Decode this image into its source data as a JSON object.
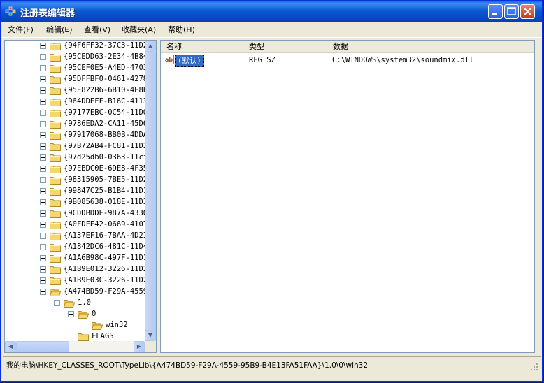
{
  "window": {
    "title": "注册表编辑器"
  },
  "menu": [
    "文件(F)",
    "编辑(E)",
    "查看(V)",
    "收藏夹(A)",
    "帮助(H)"
  ],
  "tree": [
    {
      "label": "{94F6FF32-37C3-11D2",
      "depth": 0,
      "expander": "plus"
    },
    {
      "label": "{95CEDD63-2E34-4B84",
      "depth": 0,
      "expander": "plus"
    },
    {
      "label": "{95CEF0E5-A4ED-4703",
      "depth": 0,
      "expander": "plus"
    },
    {
      "label": "{95DFFBF0-0461-4278",
      "depth": 0,
      "expander": "plus"
    },
    {
      "label": "{95E822B6-6B10-4E8E",
      "depth": 0,
      "expander": "plus"
    },
    {
      "label": "{964DDEFF-B16C-4113",
      "depth": 0,
      "expander": "plus"
    },
    {
      "label": "{97177EBC-0C54-11D0",
      "depth": 0,
      "expander": "plus"
    },
    {
      "label": "{9786EDA2-CA11-45D6",
      "depth": 0,
      "expander": "plus"
    },
    {
      "label": "{97917068-BB0B-4DDA",
      "depth": 0,
      "expander": "plus"
    },
    {
      "label": "{97B72AB4-FC81-11D2",
      "depth": 0,
      "expander": "plus"
    },
    {
      "label": "{97d25db0-0363-11cf",
      "depth": 0,
      "expander": "plus"
    },
    {
      "label": "{97EBDC0E-6DE8-4F35",
      "depth": 0,
      "expander": "plus"
    },
    {
      "label": "{98315905-7BE5-11D2",
      "depth": 0,
      "expander": "plus"
    },
    {
      "label": "{99847C25-B1B4-11D1",
      "depth": 0,
      "expander": "plus"
    },
    {
      "label": "{9B085638-018E-11D3",
      "depth": 0,
      "expander": "plus"
    },
    {
      "label": "{9CDDBDDE-987A-4330",
      "depth": 0,
      "expander": "plus"
    },
    {
      "label": "{A0FDFE42-0669-4107",
      "depth": 0,
      "expander": "plus"
    },
    {
      "label": "{A137EF16-7BAA-4D2I",
      "depth": 0,
      "expander": "plus"
    },
    {
      "label": "{A1842DC6-481C-11D4",
      "depth": 0,
      "expander": "plus"
    },
    {
      "label": "{A1A6B98C-497F-11D1",
      "depth": 0,
      "expander": "plus"
    },
    {
      "label": "{A1B9E012-3226-11D2",
      "depth": 0,
      "expander": "plus"
    },
    {
      "label": "{A1B9E03C-3226-11D2",
      "depth": 0,
      "expander": "plus"
    },
    {
      "label": "{A474BD59-F29A-4559",
      "depth": 0,
      "expander": "minus"
    },
    {
      "label": "1.0",
      "depth": 1,
      "expander": "minus"
    },
    {
      "label": "0",
      "depth": 2,
      "expander": "minus"
    },
    {
      "label": "win32",
      "depth": 3,
      "expander": "none"
    },
    {
      "label": "FLAGS",
      "depth": 2,
      "expander": "none"
    }
  ],
  "list": {
    "headers": [
      "名称",
      "类型",
      "数据"
    ],
    "rows": [
      {
        "name": "(默认)",
        "type": "REG_SZ",
        "data": "C:\\WINDOWS\\system32\\soundmix.dll"
      }
    ]
  },
  "status": {
    "path": "我的电脑\\HKEY_CLASSES_ROOT\\TypeLib\\{A474BD59-F29A-4559-95B9-B4E13FA51FAA}\\1.0\\0\\win32"
  },
  "colors": {
    "title_bar": "#0a58d0",
    "folder": "#f5d76e",
    "selection": "#316ac5"
  }
}
